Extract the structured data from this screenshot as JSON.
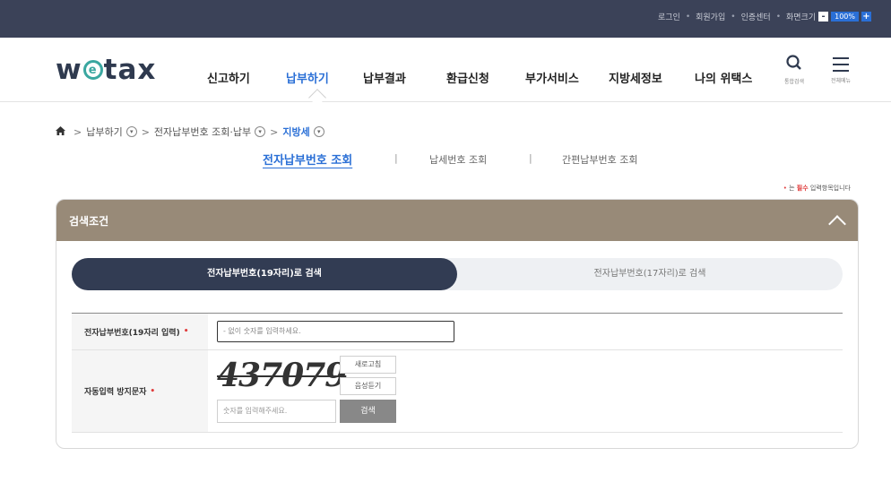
{
  "util_bar": {
    "login": "로그인",
    "signup": "회원가입",
    "cert_center": "인증센터",
    "screen_size": "화면크기",
    "zoom_minus": "-",
    "zoom_value": "100%",
    "zoom_plus": "+",
    "sep": "•"
  },
  "logo": {
    "w": "w",
    "e": "e",
    "rest": "tax"
  },
  "gnb": {
    "items": [
      "신고하기",
      "납부하기",
      "납부결과",
      "환급신청",
      "부가서비스",
      "지방세정보",
      "나의 위택스"
    ],
    "active_index": 1
  },
  "header_icons": {
    "search_label": "통합검색",
    "menu_label": "전체메뉴"
  },
  "breadcrumb": {
    "sep": ">",
    "items": [
      "납부하기",
      "전자납부번호 조회·납부",
      "지방세"
    ]
  },
  "subtabs": {
    "items": [
      "전자납부번호 조회",
      "납세번호 조회",
      "간편납부번호 조회"
    ],
    "sep": "|"
  },
  "required_note": {
    "dot": "•",
    "pre": " 는 ",
    "bold": "필수",
    "post": " 입력항목입니다"
  },
  "panel": {
    "title": "검색조건",
    "toggle_on": "전자납부번호(19자리)로 검색",
    "toggle_off": "전자납부번호(17자리)로 검색",
    "row1_label": "전자납부번호(19자리 입력)",
    "row1_placeholder": "- 없이 숫자를 입력하세요.",
    "row2_label": "자동입력 방지문자",
    "req_mark": "•",
    "captcha_text": "437079",
    "refresh_label": "새로고침",
    "audio_label": "음성듣기",
    "captcha_placeholder": "숫자를 입력해주세요.",
    "search_label": "검색"
  }
}
